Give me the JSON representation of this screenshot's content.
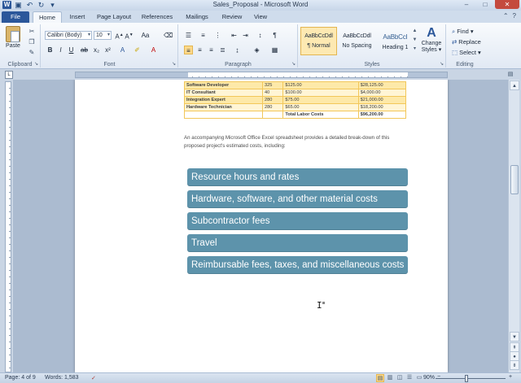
{
  "window": {
    "title": "Sales_Proposal - Microsoft Word",
    "controls": {
      "minimize": "–",
      "maximize": "□",
      "close": "✕"
    }
  },
  "qat_icons": [
    "word-logo",
    "save-icon",
    "undo-icon",
    "redo-icon",
    "customize-icon"
  ],
  "tabs": [
    "File",
    "Home",
    "Insert",
    "Page Layout",
    "References",
    "Mailings",
    "Review",
    "View"
  ],
  "active_tab": "Home",
  "ribbon": {
    "clipboard": {
      "label": "Clipboard",
      "paste": "Paste"
    },
    "font": {
      "label": "Font",
      "font_name": "Calibri (Body)",
      "font_size": "10"
    },
    "paragraph": {
      "label": "Paragraph"
    },
    "styles": {
      "label": "Styles",
      "items": [
        {
          "sample": "AaBbCcDdl",
          "name": "¶ Normal"
        },
        {
          "sample": "AaBbCcDdl",
          "name": "No Spacing"
        },
        {
          "sample": "AaBbCcI",
          "name": "Heading 1"
        }
      ],
      "change_styles": [
        "Change",
        "Styles ▾"
      ]
    },
    "editing": {
      "label": "Editing",
      "find": "Find ▾",
      "replace": "Replace",
      "select": "Select ▾"
    }
  },
  "document": {
    "table": {
      "rows": [
        [
          "Software Developer",
          "325",
          "$125.00",
          "$28,125.00"
        ],
        [
          "IT Consultant",
          "40",
          "$100.00",
          "$4,000.00"
        ],
        [
          "Integration Expert",
          "280",
          "$75.00",
          "$21,000.00"
        ],
        [
          "Hardware Technician",
          "280",
          "$65.00",
          "$18,200.00"
        ]
      ],
      "total_label": "Total Labor Costs",
      "total_value": "$96,200.00"
    },
    "paragraph": "An accompanying Microsoft Office Excel spreadsheet provides a detailed break-down of this proposed project's estimated costs, including:",
    "list": [
      "Resource hours and rates",
      "Hardware, software, and other material costs",
      "Subcontractor fees",
      "Travel",
      "Reimbursable fees, taxes, and miscellaneous costs"
    ]
  },
  "status": {
    "page": "Page: 4 of 9",
    "words": "Words: 1,583",
    "zoom": "90%",
    "zoom_level_percent": 90
  },
  "colors": {
    "accent": "#2b579a",
    "list_fill": "#5d93ab",
    "table_band": "#fde9a9",
    "table_border": "#f2c75a"
  }
}
